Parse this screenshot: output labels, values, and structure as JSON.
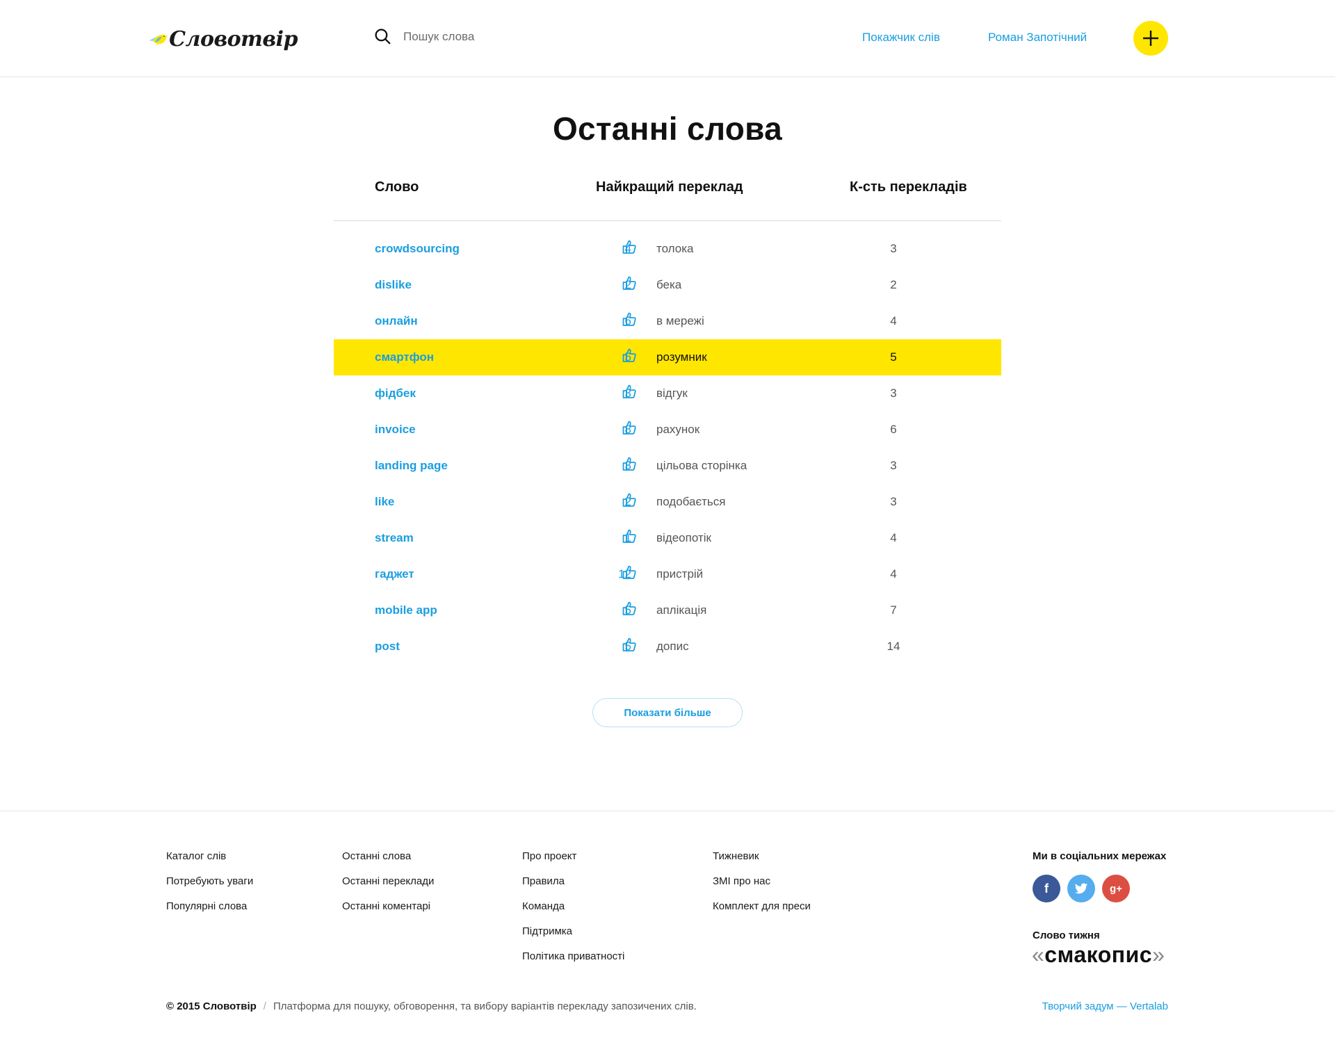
{
  "header": {
    "logo_text": "Словотвір",
    "search_placeholder": "Пошук слова",
    "nav_index": "Покажчик слів",
    "nav_user": "Роман Запотічний"
  },
  "main": {
    "title": "Останні слова",
    "columns": {
      "word": "Слово",
      "best": "Найкращий переклад",
      "count": "К-сть перекладів"
    },
    "rows": [
      {
        "word": "crowdsourcing",
        "votes": "4",
        "translation": "толока",
        "count": "3"
      },
      {
        "word": "dislike",
        "votes": "2",
        "translation": "бека",
        "count": "2"
      },
      {
        "word": "онлайн",
        "votes": "6",
        "translation": "в мережі",
        "count": "4"
      },
      {
        "word": "смартфон",
        "votes": "5",
        "translation": "розумник",
        "count": "5"
      },
      {
        "word": "фідбек",
        "votes": "3",
        "translation": "відгук",
        "count": "3"
      },
      {
        "word": "invoice",
        "votes": "8",
        "translation": "рахунок",
        "count": "6"
      },
      {
        "word": "landing page",
        "votes": "3",
        "translation": "цільова сторінка",
        "count": "3"
      },
      {
        "word": "like",
        "votes": "2",
        "translation": "подобається",
        "count": "3"
      },
      {
        "word": "stream",
        "votes": "1",
        "translation": "відеопотік",
        "count": "4"
      },
      {
        "word": "гаджет",
        "votes": "12",
        "translation": "пристрій",
        "count": "4"
      },
      {
        "word": "mobile app",
        "votes": "5",
        "translation": "аплікація",
        "count": "7"
      },
      {
        "word": "post",
        "votes": "5",
        "translation": "допис",
        "count": "14"
      }
    ],
    "more_button": "Показати більше"
  },
  "footer": {
    "col1": [
      "Каталог слів",
      "Потребують уваги",
      "Популярні слова"
    ],
    "col2": [
      "Останні слова",
      "Останні переклади",
      "Останні коментарі"
    ],
    "col3": [
      "Про проект",
      "Правила",
      "Команда",
      "Підтримка",
      "Політика приватності"
    ],
    "col4": [
      "Тижневик",
      "ЗМІ про нас",
      "Комплект для преси"
    ],
    "social_title": "Ми в соціальних мережах",
    "social_icons": [
      "facebook-icon",
      "twitter-icon",
      "google-plus-icon"
    ],
    "word_of_week_label": "Слово тижня",
    "word_of_week_open": "«",
    "word_of_week": "смакопис",
    "word_of_week_close": "»",
    "copyright_brand": "© 2015 Словотвір",
    "copyright_sep": "/",
    "copyright_text": "Платформа для пошуку, обговорення, та вибору варіантів перекладу запозичених слів.",
    "credits": "Творчий задум — Vertalab"
  },
  "colors": {
    "accent_blue": "#1a9ee0",
    "highlight_yellow": "#ffe600",
    "facebook": "#3b5998",
    "twitter": "#55acee",
    "google_plus": "#dc4e41"
  },
  "state": {
    "highlighted_row": 3
  }
}
